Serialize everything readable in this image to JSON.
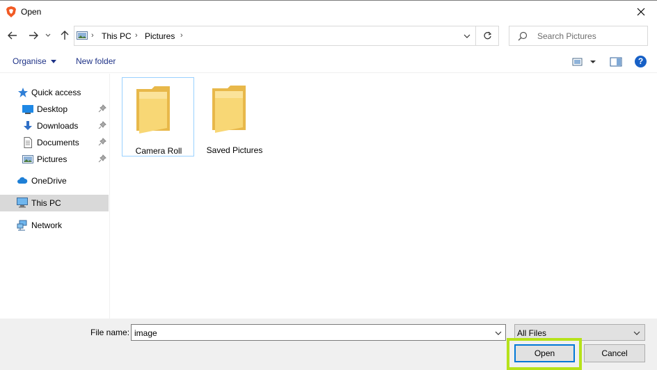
{
  "window": {
    "title": "Open"
  },
  "address": {
    "crumbs": [
      "This PC",
      "Pictures"
    ]
  },
  "search": {
    "placeholder": "Search Pictures"
  },
  "toolbar": {
    "organise_label": "Organise",
    "new_folder_label": "New folder"
  },
  "sidebar": {
    "items": [
      {
        "label": "Quick access",
        "icon": "star-icon"
      },
      {
        "label": "Desktop",
        "icon": "desktop-icon",
        "pinned": true
      },
      {
        "label": "Downloads",
        "icon": "download-icon",
        "pinned": true
      },
      {
        "label": "Documents",
        "icon": "document-icon",
        "pinned": true
      },
      {
        "label": "Pictures",
        "icon": "pictures-icon",
        "pinned": true
      },
      {
        "label": "OneDrive",
        "icon": "cloud-icon"
      },
      {
        "label": "This PC",
        "icon": "computer-icon",
        "selected": true
      },
      {
        "label": "Network",
        "icon": "network-icon"
      }
    ]
  },
  "folders": [
    {
      "name": "Camera Roll"
    },
    {
      "name": "Saved Pictures"
    }
  ],
  "bottom": {
    "file_name_label": "File name:",
    "file_name_value": "image",
    "file_type_value": "All Files",
    "open_label": "Open",
    "cancel_label": "Cancel"
  },
  "colors": {
    "accent": "#0078d7",
    "highlight": "#b6e21a",
    "folder": "#f8d775",
    "link": "#1e3287"
  }
}
